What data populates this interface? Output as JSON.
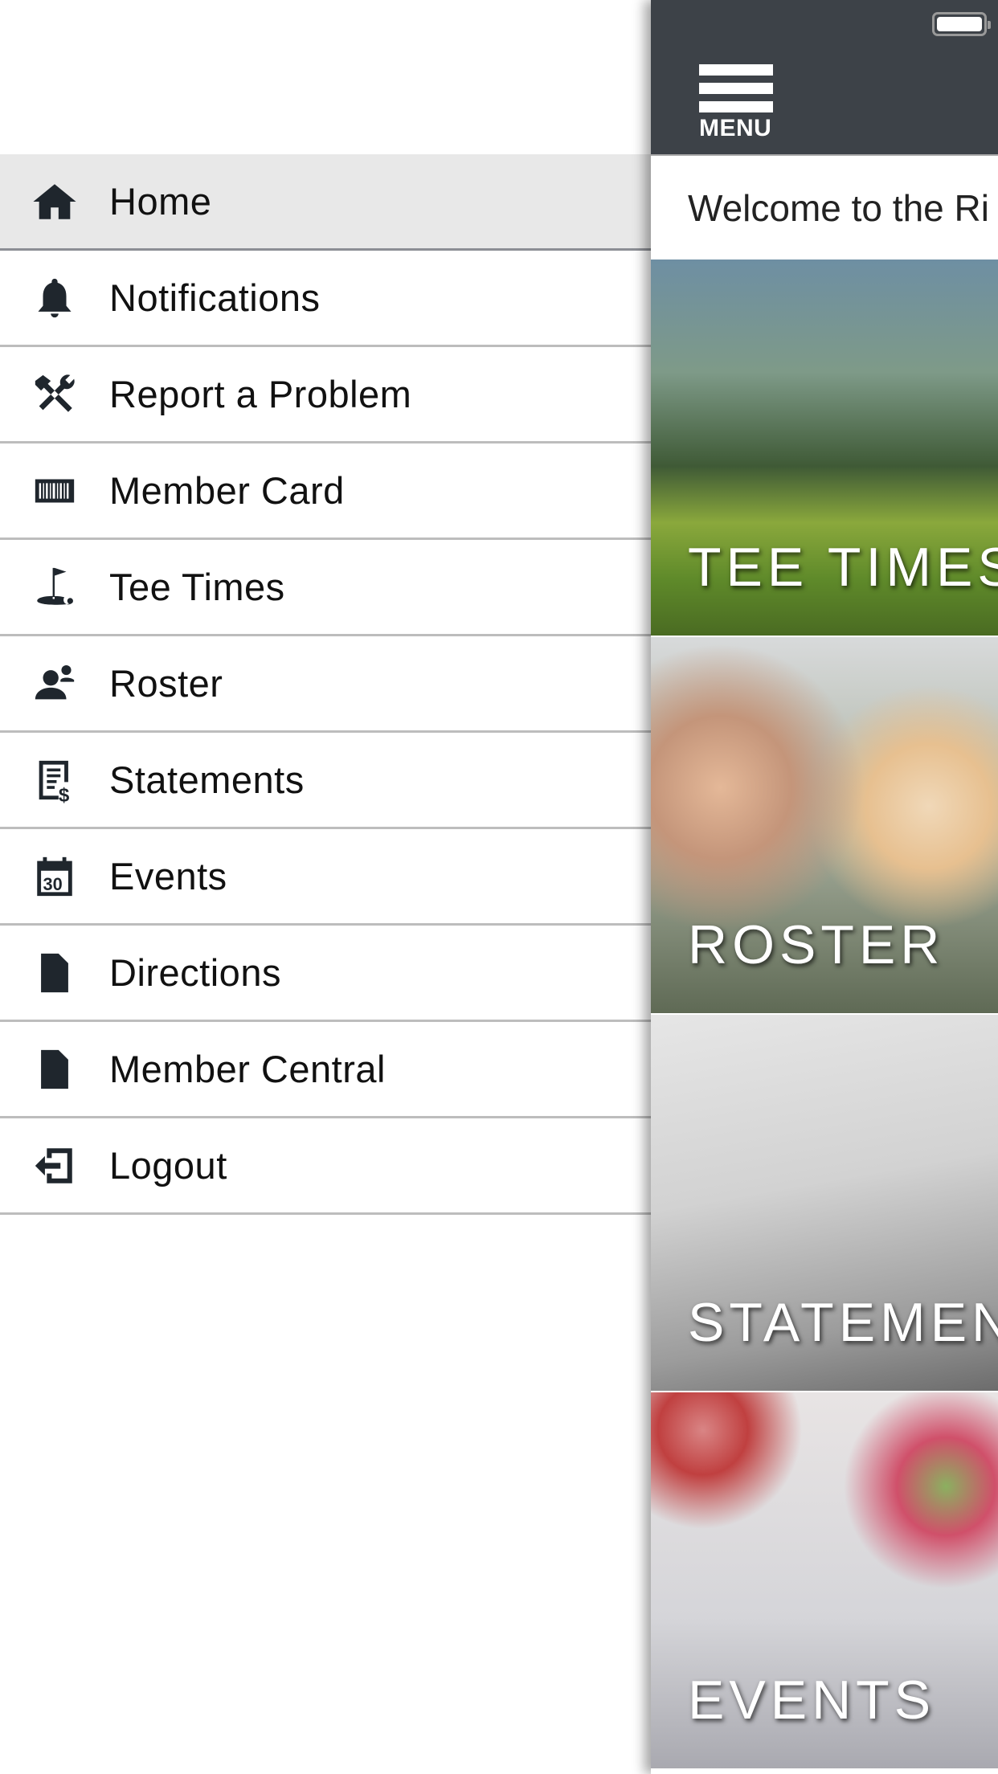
{
  "drawer": {
    "items": [
      {
        "label": "Home",
        "icon": "home-icon",
        "active": true
      },
      {
        "label": "Notifications",
        "icon": "bell-icon"
      },
      {
        "label": "Report a Problem",
        "icon": "tools-icon"
      },
      {
        "label": "Member Card",
        "icon": "barcode-card-icon"
      },
      {
        "label": "Tee Times",
        "icon": "golf-flag-icon"
      },
      {
        "label": "Roster",
        "icon": "person-icon"
      },
      {
        "label": "Statements",
        "icon": "statement-icon"
      },
      {
        "label": "Events",
        "icon": "calendar-icon",
        "calendar_day": "30"
      },
      {
        "label": "Directions",
        "icon": "document-icon"
      },
      {
        "label": "Member Central",
        "icon": "document-icon"
      },
      {
        "label": "Logout",
        "icon": "logout-icon"
      }
    ]
  },
  "header": {
    "menu_label": "MENU",
    "background": "#3d4248"
  },
  "welcome": "Welcome to the Ri",
  "tiles": [
    {
      "label": "TEE TIMES"
    },
    {
      "label": "ROSTER"
    },
    {
      "label": "STATEMENTS"
    },
    {
      "label": "EVENTS"
    }
  ]
}
